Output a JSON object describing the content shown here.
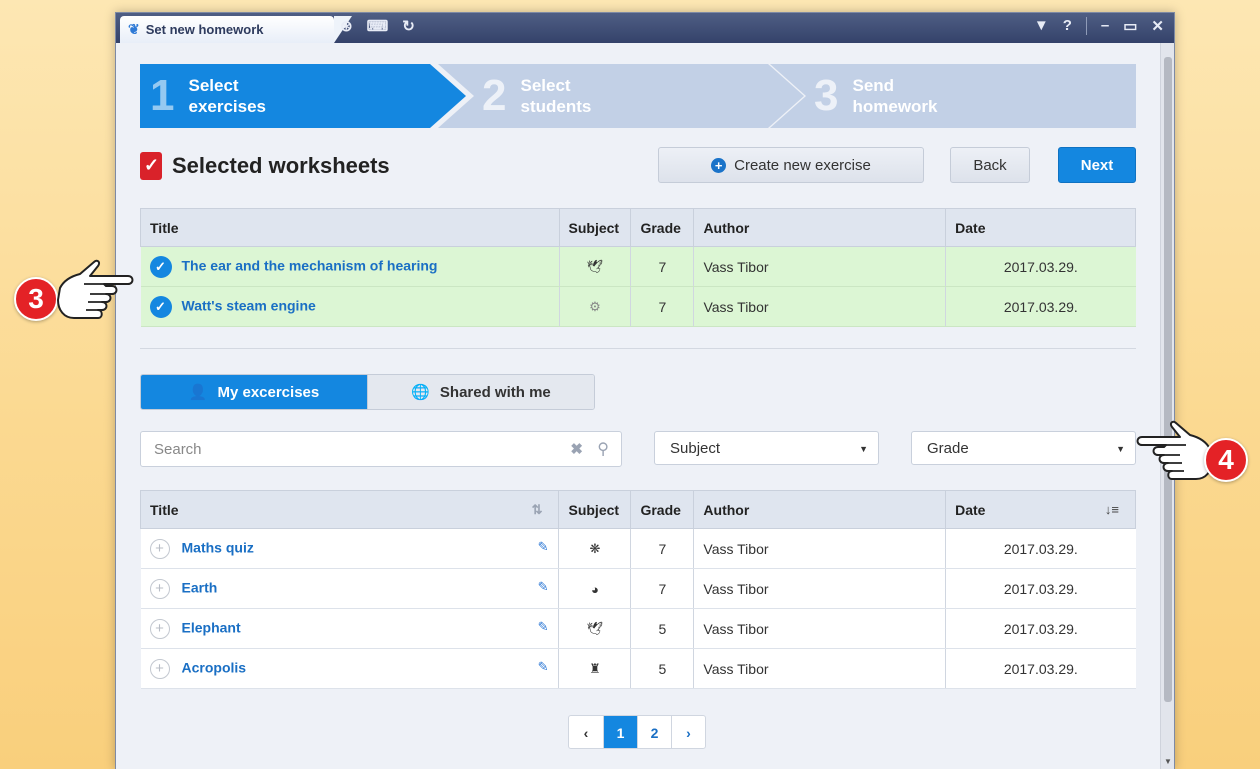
{
  "window": {
    "tab_title": "Set new homework"
  },
  "steps": [
    {
      "number": "1",
      "label": "Select\nexercises"
    },
    {
      "number": "2",
      "label": "Select\nstudents"
    },
    {
      "number": "3",
      "label": "Send\nhomework"
    }
  ],
  "header": {
    "title": "Selected worksheets",
    "create_label": "Create new exercise",
    "back_label": "Back",
    "next_label": "Next"
  },
  "selected_table": {
    "columns": [
      "Title",
      "Subject",
      "Grade",
      "Author",
      "Date"
    ],
    "rows": [
      {
        "title": "The ear and the mechanism of hearing",
        "subject_icon": "bird-icon",
        "grade": "7",
        "author": "Vass Tibor",
        "date": "2017.03.29."
      },
      {
        "title": "Watt's steam engine",
        "subject_icon": "gear-icon",
        "grade": "7",
        "author": "Vass Tibor",
        "date": "2017.03.29."
      }
    ]
  },
  "toggle": {
    "my_label": "My excercises",
    "shared_label": "Shared with me"
  },
  "filters": {
    "search_placeholder": "Search",
    "subject_value": "Subject",
    "grade_value": "Grade"
  },
  "exercise_table": {
    "columns": [
      "Title",
      "Subject",
      "Grade",
      "Author",
      "Date"
    ],
    "rows": [
      {
        "title": "Maths quiz",
        "subject_icon": "brain-icon",
        "grade": "7",
        "author": "Vass Tibor",
        "date": "2017.03.29."
      },
      {
        "title": "Earth",
        "subject_icon": "globe-icon",
        "grade": "7",
        "author": "Vass Tibor",
        "date": "2017.03.29."
      },
      {
        "title": "Elephant",
        "subject_icon": "bird-icon",
        "grade": "5",
        "author": "Vass Tibor",
        "date": "2017.03.29."
      },
      {
        "title": "Acropolis",
        "subject_icon": "helmet-icon",
        "grade": "5",
        "author": "Vass Tibor",
        "date": "2017.03.29."
      }
    ]
  },
  "pagination": {
    "pages": [
      "1",
      "2"
    ],
    "current": "1"
  },
  "callouts": [
    "3",
    "4"
  ],
  "colors": {
    "accent": "#1487e0",
    "selected_row": "#dcf6d4",
    "callout": "#e42226",
    "titlebar": "#3d4b72"
  }
}
